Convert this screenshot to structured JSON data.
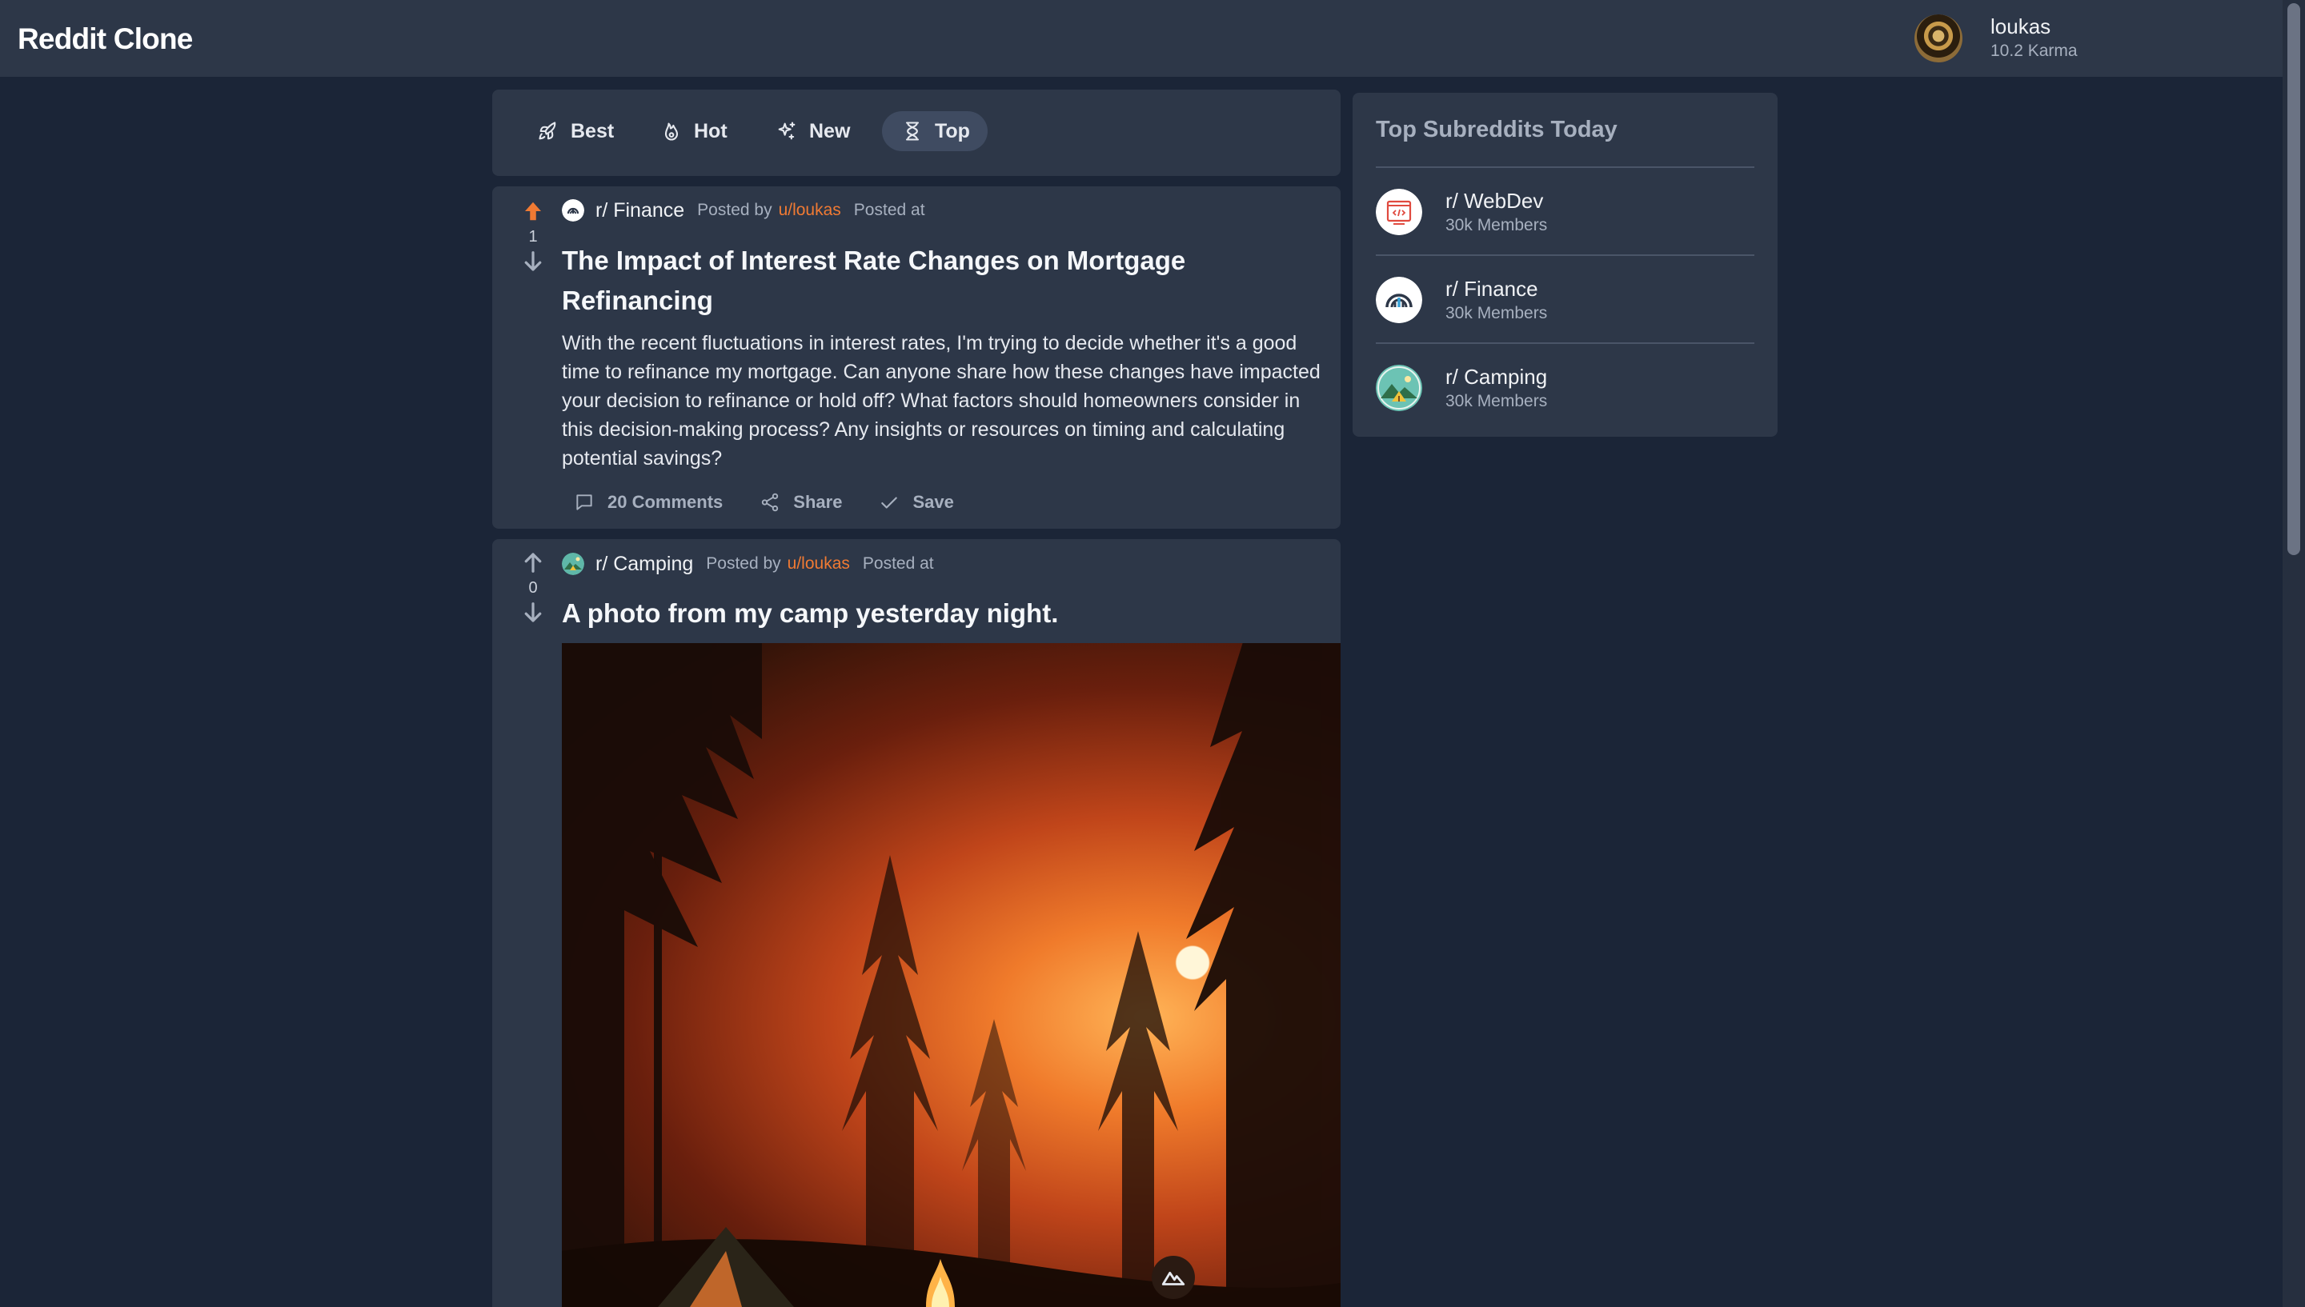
{
  "app": {
    "title": "Reddit Clone"
  },
  "user": {
    "name": "loukas",
    "karma": "10.2 Karma"
  },
  "sort": {
    "tabs": [
      {
        "label": "Best",
        "icon": "rocket-icon"
      },
      {
        "label": "Hot",
        "icon": "flame-icon"
      },
      {
        "label": "New",
        "icon": "sparkles-icon"
      },
      {
        "label": "Top",
        "icon": "hourglass-icon"
      }
    ],
    "active": "Top"
  },
  "posts": [
    {
      "score": "1",
      "upvoted": true,
      "subreddit": "r/ Finance",
      "posted_by_label": "Posted by",
      "author": "u/loukas",
      "posted_at_label": "Posted at",
      "title": "The Impact of Interest Rate Changes on Mortgage Refinancing",
      "body": "With the recent fluctuations in interest rates, I'm trying to decide whether it's a good time to refinance my mortgage. Can anyone share how these changes have impacted your decision to refinance or hold off? What factors should homeowners consider in this decision-making process? Any insights or resources on timing and calculating potential savings?",
      "actions": {
        "comments": "20 Comments",
        "share": "Share",
        "save": "Save"
      }
    },
    {
      "score": "0",
      "upvoted": false,
      "subreddit": "r/ Camping",
      "posted_by_label": "Posted by",
      "author": "u/loukas",
      "posted_at_label": "Posted at",
      "title": "A photo from my camp yesterday night.",
      "image": "forest-sunset-campsite-photo"
    }
  ],
  "sidebar": {
    "title": "Top Subreddits Today",
    "items": [
      {
        "name": "r/ WebDev",
        "members": "30k Members",
        "icon": "code-window-icon"
      },
      {
        "name": "r/ Finance",
        "members": "30k Members",
        "icon": "finance-chart-icon"
      },
      {
        "name": "r/ Camping",
        "members": "30k Members",
        "icon": "mountain-tent-icon"
      }
    ]
  },
  "colors": {
    "page_bg": "#1b2537",
    "panel_bg": "#2d3748",
    "accent_orange": "#f07a33",
    "muted_text": "#a7b0bf"
  }
}
